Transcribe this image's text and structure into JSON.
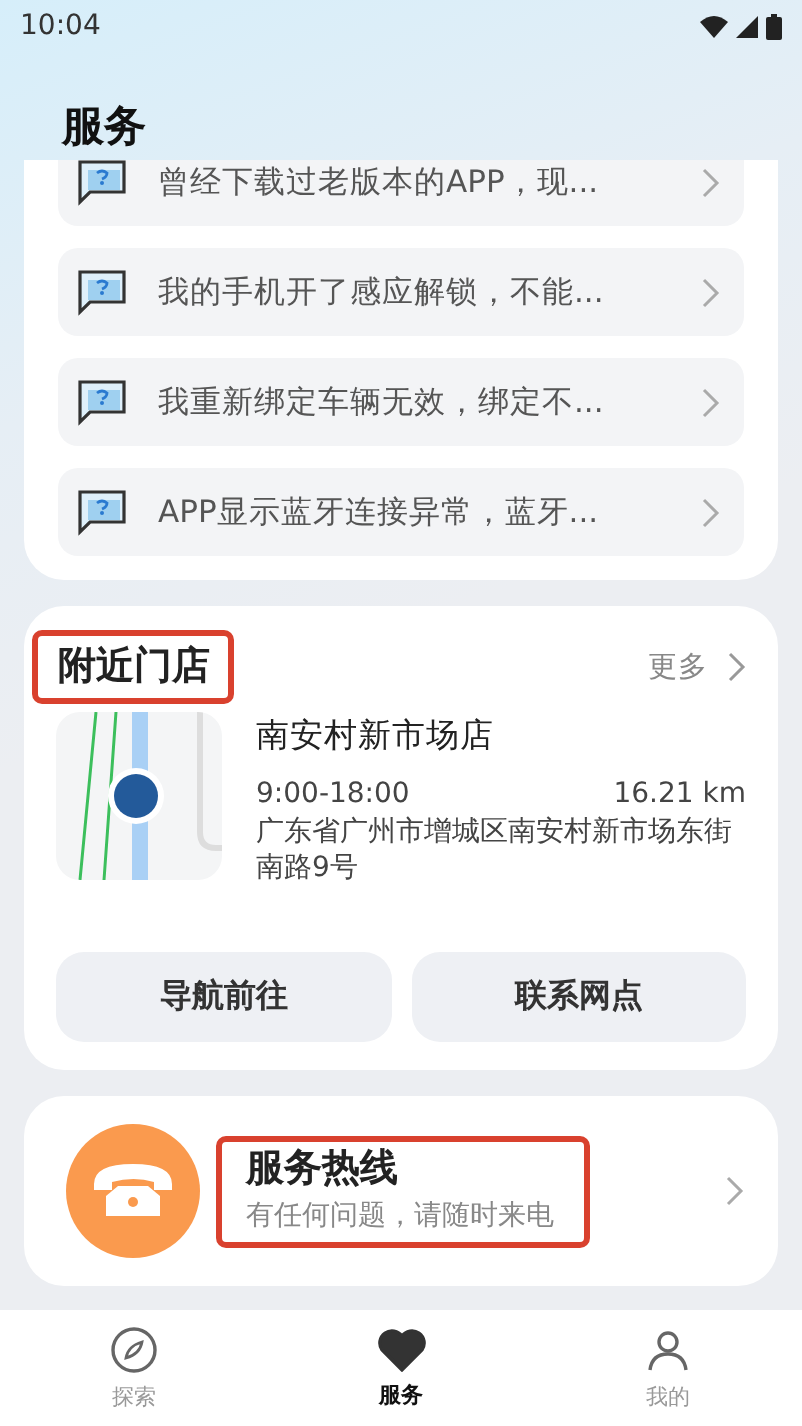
{
  "status_bar": {
    "time": "10:04"
  },
  "header": {
    "title": "服务"
  },
  "faq": [
    {
      "text": "曾经下载过老版本的APP，现..."
    },
    {
      "text": "我的手机开了感应解锁，不能..."
    },
    {
      "text": "我重新绑定车辆无效，绑定不..."
    },
    {
      "text": "APP显示蓝牙连接异常，蓝牙..."
    }
  ],
  "nearby": {
    "title": "附近门店",
    "highlighted": true,
    "more": "更多",
    "store": {
      "name": "南安村新市场店",
      "hours": "9:00-18:00",
      "distance": "16.21 km",
      "address": "广东省广州市增城区南安村新市场东街南路9号"
    },
    "buttons": [
      "导航前往",
      "联系网点"
    ]
  },
  "hotline": {
    "title": "服务热线",
    "subtitle": "有任何问题，请随时来电",
    "highlighted": true
  },
  "tabs": [
    {
      "label": "探索",
      "kind": "compass",
      "selected": false
    },
    {
      "label": "服务",
      "kind": "heart",
      "selected": true
    },
    {
      "label": "我的",
      "kind": "person",
      "selected": false
    }
  ]
}
